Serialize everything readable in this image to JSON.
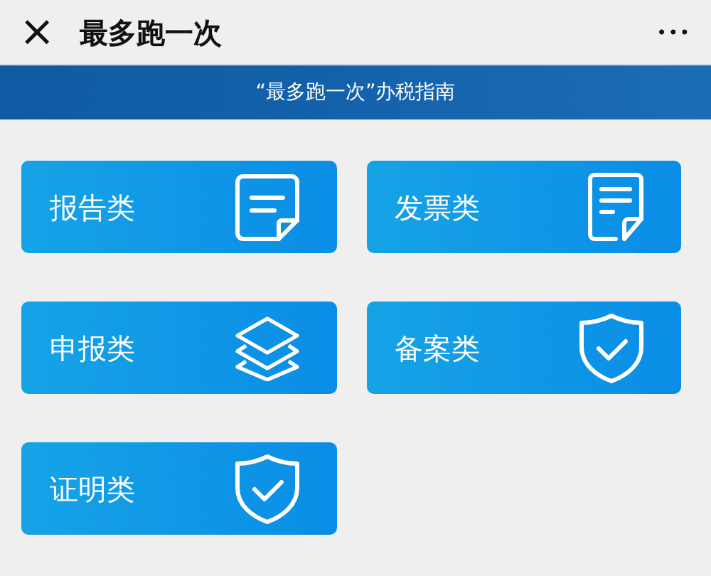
{
  "header": {
    "close": "×",
    "title": "最多跑一次",
    "more": "•••"
  },
  "banner": {
    "title": "“最多跑一次”办税指南"
  },
  "categories": [
    {
      "label": "报告类",
      "kind": "note"
    },
    {
      "label": "发票类",
      "kind": "invoice"
    },
    {
      "label": "申报类",
      "kind": "layers"
    },
    {
      "label": "备案类",
      "kind": "shield"
    },
    {
      "label": "证明类",
      "kind": "shield"
    }
  ]
}
